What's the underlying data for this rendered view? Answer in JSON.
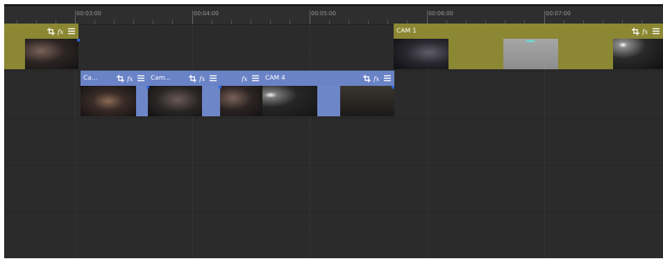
{
  "ruler": {
    "ticks": [
      "00:03:00",
      "00:04:00",
      "00:05:00",
      "00:06:00",
      "00:07:00"
    ]
  },
  "clips": {
    "leftgold": {
      "title": ""
    },
    "cam1": {
      "title": "CAM 1"
    },
    "ca": {
      "title": "Ca..."
    },
    "cam": {
      "title": "Cam..."
    },
    "blank": {
      "title": ""
    },
    "cam4": {
      "title": "CAM 4"
    }
  },
  "icons": [
    "crop-icon",
    "fx-icon",
    "menu-icon"
  ],
  "colors": {
    "track_bg": "#2b2b2b",
    "ruler_bg": "#2e2e2e",
    "gold_clip": "#8b8733",
    "blue_clip": "#6a83c6",
    "selection_nub": "#6fd6d0"
  }
}
